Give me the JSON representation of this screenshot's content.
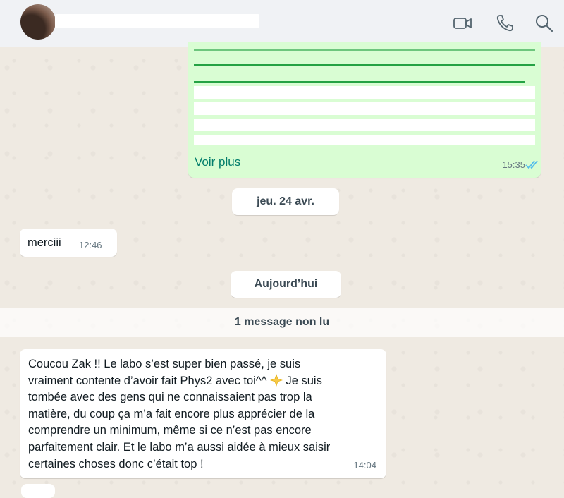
{
  "header": {
    "contact_name": "",
    "actions": [
      "video-call-icon",
      "voice-call-icon",
      "search-icon"
    ]
  },
  "outgoing_message": {
    "see_more_label": "Voir plus",
    "time": "15:35",
    "status": "read",
    "tick_color": "#53bdeb"
  },
  "date_separators": {
    "first": "jeu. 24 avr.",
    "second": "Aujourd’hui"
  },
  "short_message": {
    "text": "merciii",
    "time": "12:46"
  },
  "unread_banner": "1 message non lu",
  "long_message": {
    "lines": [
      "Coucou Zak !! Le labo s’est super bien passé, je suis",
      "vraiment contente d’avoir fait Phys2 avec toi^^ ",
      " Je suis",
      "tombée avec des gens qui ne connaissaient pas trop la",
      "matière, du coup ça m’a fait encore plus apprécier de la",
      "comprendre un minimum, même si ce n’est pas encore",
      "parfaitement clair. Et le labo m’a aussi aidée à mieux saisir",
      "certaines choses donc c’était top !"
    ],
    "time": "14:04",
    "emoji": "sparkle-star-icon"
  },
  "colors": {
    "outgoing_bubble": "#d9fdd3",
    "accent_link": "#027d6b",
    "chat_background": "#efeae2"
  }
}
